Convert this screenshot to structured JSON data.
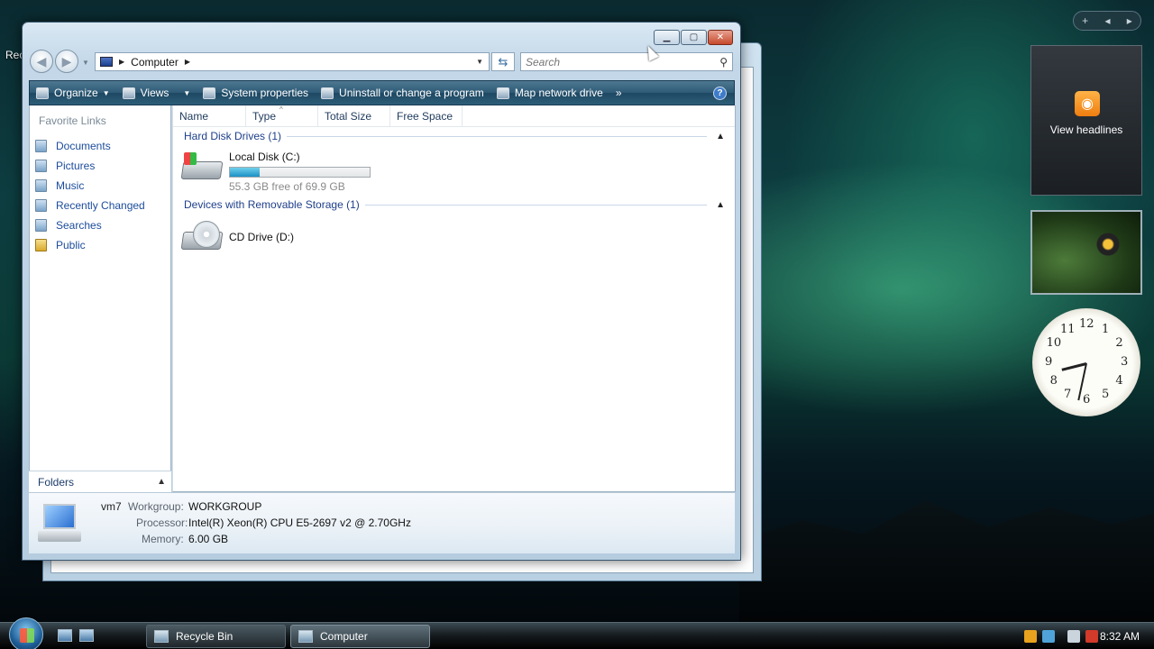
{
  "desktop": {
    "recycle_bin_label": "Rec"
  },
  "window": {
    "address": {
      "crumb": "Computer"
    },
    "search": {
      "placeholder": "Search"
    },
    "toolbar": {
      "organize": "Organize",
      "views": "Views",
      "system_properties": "System properties",
      "uninstall": "Uninstall or change a program",
      "map_drive": "Map network drive",
      "more": "»",
      "help": "?"
    },
    "nav": {
      "title": "Favorite Links",
      "items": [
        {
          "label": "Documents",
          "icon": "documents-icon"
        },
        {
          "label": "Pictures",
          "icon": "pictures-icon"
        },
        {
          "label": "Music",
          "icon": "music-icon"
        },
        {
          "label": "Recently Changed",
          "icon": "recent-icon"
        },
        {
          "label": "Searches",
          "icon": "searches-icon"
        },
        {
          "label": "Public",
          "icon": "folder-icon"
        }
      ],
      "folders_label": "Folders"
    },
    "columns": [
      "Name",
      "Type",
      "Total Size",
      "Free Space"
    ],
    "groups": {
      "hdd": "Hard Disk Drives (1)",
      "removable": "Devices with Removable Storage (1)"
    },
    "drives": {
      "c": {
        "name": "Local Disk (C:)",
        "space": "55.3 GB free of 69.9 GB",
        "used_fraction": 0.21
      },
      "d": {
        "name": "CD Drive (D:)"
      }
    },
    "details": {
      "computer_name": "vm7",
      "workgroup_label": "Workgroup:",
      "workgroup": "WORKGROUP",
      "processor_label": "Processor:",
      "processor": "Intel(R) Xeon(R) CPU E5-2697 v2 @ 2.70GHz",
      "memory_label": "Memory:",
      "memory": "6.00 GB"
    }
  },
  "gadgets": {
    "feeds_label": "View headlines",
    "clock_numbers": [
      "12",
      "1",
      "2",
      "3",
      "4",
      "5",
      "6",
      "7",
      "8",
      "9",
      "10",
      "11"
    ]
  },
  "taskbar": {
    "tasks": [
      {
        "label": "Recycle Bin"
      },
      {
        "label": "Computer"
      }
    ],
    "time": "8:32 AM"
  },
  "colors": {
    "link": "#1c4c9c",
    "toolbar": "#2e5a76",
    "bar_fill": "#1c8fc4"
  }
}
